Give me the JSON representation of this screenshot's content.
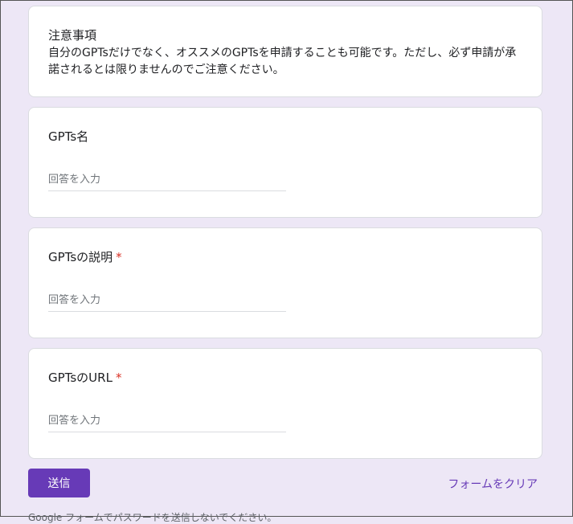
{
  "notice": {
    "title": "注意事項",
    "body": "自分のGPTsだけでなく、オススメのGPTsを申請することも可能です。ただし、必ず申請が承諾されるとは限りませんのでご注意ください。"
  },
  "questions": [
    {
      "title": "GPTs名",
      "required": "",
      "placeholder": "回答を入力"
    },
    {
      "title": "GPTsの説明",
      "required": "*",
      "placeholder": "回答を入力"
    },
    {
      "title": "GPTsのURL",
      "required": "*",
      "placeholder": "回答を入力"
    }
  ],
  "actions": {
    "submit_label": "送信",
    "clear_label": "フォームをクリア"
  },
  "footer": {
    "note": "Google フォームでパスワードを送信しないでください。"
  },
  "colors": {
    "background": "#ede7f6",
    "accent": "#673ab7",
    "required": "#d93025"
  }
}
